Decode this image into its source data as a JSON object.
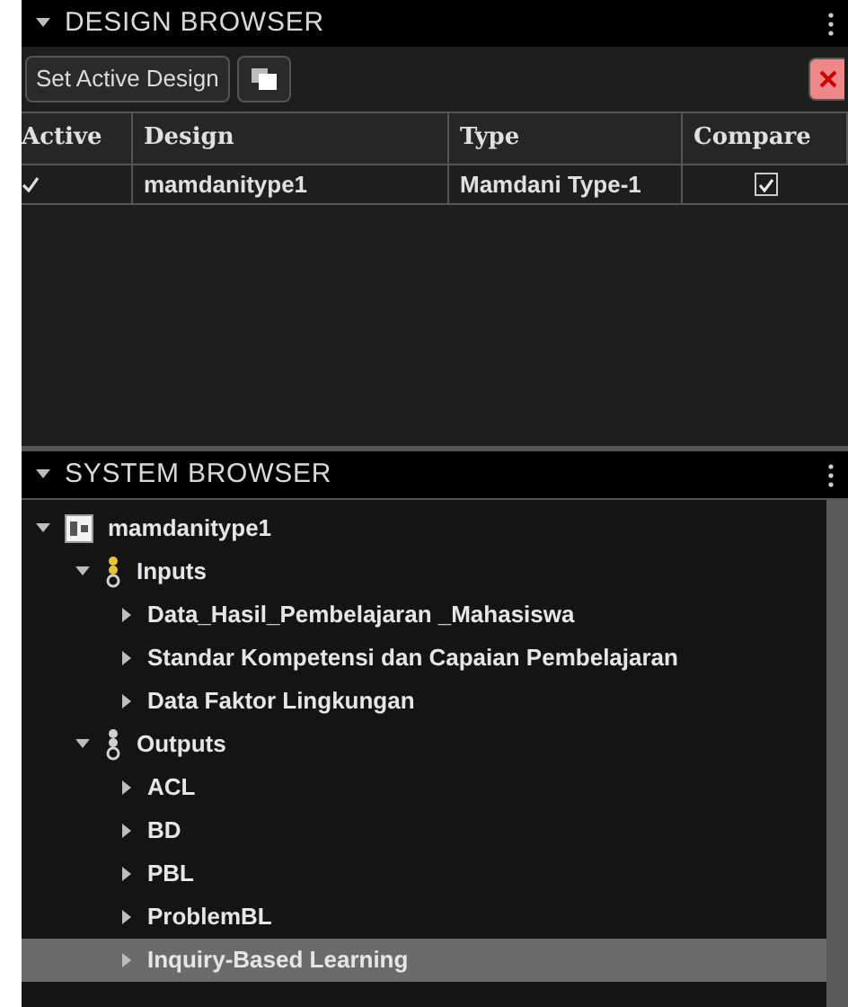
{
  "design_browser": {
    "title": "DESIGN BROWSER",
    "expanded": true,
    "toolbar": {
      "set_active_button": "Set Active Design"
    },
    "table": {
      "columns": [
        "Active",
        "Design",
        "Type",
        "Compare"
      ],
      "rows": [
        {
          "active": true,
          "design": "mamdanitype1",
          "type": "Mamdani Type-1",
          "compare": true
        }
      ]
    }
  },
  "system_browser": {
    "title": "SYSTEM BROWSER",
    "expanded": true,
    "tree": [
      {
        "label": "mamdanitype1",
        "kind": "system",
        "expanded": true,
        "selected": false,
        "children": [
          {
            "label": "Inputs",
            "kind": "inputs",
            "expanded": true,
            "selected": false,
            "children": [
              {
                "label": "Data_Hasil_Pembelajaran _Mahasiswa",
                "expanded": false,
                "selected": false
              },
              {
                "label": "Standar Kompetensi dan Capaian Pembelajaran",
                "expanded": false,
                "selected": false
              },
              {
                "label": "Data Faktor Lingkungan",
                "expanded": false,
                "selected": false
              }
            ]
          },
          {
            "label": "Outputs",
            "kind": "outputs",
            "expanded": true,
            "selected": false,
            "children": [
              {
                "label": "ACL",
                "expanded": false,
                "selected": false
              },
              {
                "label": "BD",
                "expanded": false,
                "selected": false
              },
              {
                "label": "PBL",
                "expanded": false,
                "selected": false
              },
              {
                "label": "ProblemBL",
                "expanded": false,
                "selected": false
              },
              {
                "label": "Inquiry-Based Learning",
                "expanded": false,
                "selected": true
              }
            ]
          }
        ]
      }
    ]
  }
}
